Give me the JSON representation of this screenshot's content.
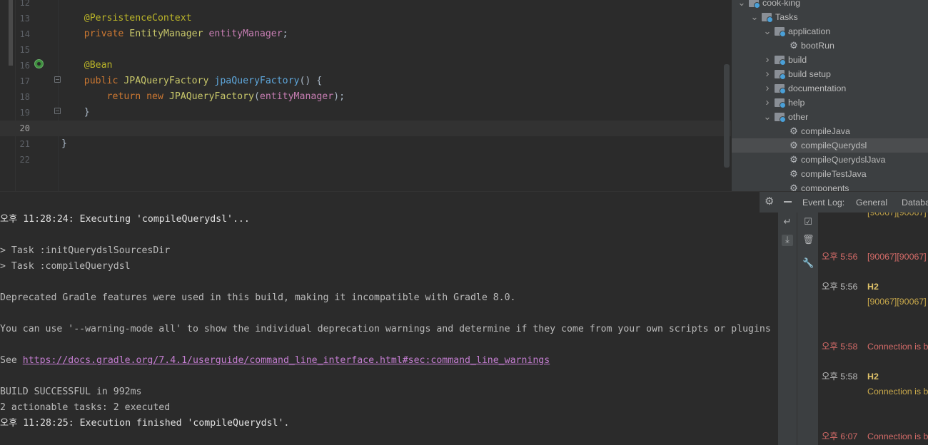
{
  "editor": {
    "lines": [
      {
        "num": "12",
        "tokens": []
      },
      {
        "num": "13",
        "tokens": [
          {
            "t": "    ",
            "c": "plain"
          },
          {
            "t": "@PersistenceContext",
            "c": "ann"
          }
        ]
      },
      {
        "num": "14",
        "tokens": [
          {
            "t": "    ",
            "c": "plain"
          },
          {
            "t": "private ",
            "c": "kw"
          },
          {
            "t": "EntityManager ",
            "c": "type"
          },
          {
            "t": "entityManager",
            "c": "field"
          },
          {
            "t": ";",
            "c": "plain"
          }
        ]
      },
      {
        "num": "15",
        "tokens": []
      },
      {
        "num": "16",
        "tokens": [
          {
            "t": "    ",
            "c": "plain"
          },
          {
            "t": "@Bean",
            "c": "ann"
          }
        ]
      },
      {
        "num": "17",
        "tokens": [
          {
            "t": "    ",
            "c": "plain"
          },
          {
            "t": "public ",
            "c": "kw"
          },
          {
            "t": "JPAQueryFactory ",
            "c": "type"
          },
          {
            "t": "jpaQueryFactory",
            "c": "fn"
          },
          {
            "t": "() {",
            "c": "plain"
          }
        ]
      },
      {
        "num": "18",
        "tokens": [
          {
            "t": "        ",
            "c": "plain"
          },
          {
            "t": "return new ",
            "c": "kw"
          },
          {
            "t": "JPAQueryFactory",
            "c": "type"
          },
          {
            "t": "(",
            "c": "plain"
          },
          {
            "t": "entityManager",
            "c": "field"
          },
          {
            "t": ");",
            "c": "plain"
          }
        ]
      },
      {
        "num": "19",
        "tokens": [
          {
            "t": "    }",
            "c": "plain"
          }
        ]
      },
      {
        "num": "20",
        "tokens": []
      },
      {
        "num": "21",
        "tokens": [
          {
            "t": "}",
            "c": "plain"
          }
        ]
      },
      {
        "num": "22",
        "tokens": []
      }
    ]
  },
  "gradle_tree": {
    "items": [
      {
        "label": "cook-king",
        "chevron": "open",
        "icon": "project-icon",
        "level": 0
      },
      {
        "label": "Tasks",
        "chevron": "open",
        "icon": "folder-icon",
        "level": 1
      },
      {
        "label": "application",
        "chevron": "open",
        "icon": "folder-icon",
        "level": 2
      },
      {
        "label": "bootRun",
        "chevron": "none",
        "icon": "gear-icon",
        "level": 3
      },
      {
        "label": "build",
        "chevron": "closed",
        "icon": "folder-icon",
        "level": 2
      },
      {
        "label": "build setup",
        "chevron": "closed",
        "icon": "folder-icon",
        "level": 2
      },
      {
        "label": "documentation",
        "chevron": "closed",
        "icon": "folder-icon",
        "level": 2
      },
      {
        "label": "help",
        "chevron": "closed",
        "icon": "folder-icon",
        "level": 2
      },
      {
        "label": "other",
        "chevron": "open",
        "icon": "folder-icon",
        "level": 2
      },
      {
        "label": "compileJava",
        "chevron": "none",
        "icon": "gear-icon",
        "level": 3
      },
      {
        "label": "compileQuerydsl",
        "chevron": "none",
        "icon": "gear-icon",
        "level": 3,
        "selected": true
      },
      {
        "label": "compileQuerydslJava",
        "chevron": "none",
        "icon": "gear-icon",
        "level": 3
      },
      {
        "label": "compileTestJava",
        "chevron": "none",
        "icon": "gear-icon",
        "level": 3
      },
      {
        "label": "components",
        "chevron": "none",
        "icon": "gear-icon",
        "level": 3
      }
    ]
  },
  "event_log_bar": {
    "label": "Event Log:",
    "tabs": [
      "General",
      "Databa"
    ]
  },
  "console": {
    "lines": [
      {
        "text": "오후 11:28:24: Executing 'compileQuerydsl'...",
        "bright": true
      },
      {
        "text": ""
      },
      {
        "text": "> Task :initQuerydslSourcesDir"
      },
      {
        "text": "> Task :compileQuerydsl"
      },
      {
        "text": ""
      },
      {
        "text": "Deprecated Gradle features were used in this build, making it incompatible with Gradle 8.0."
      },
      {
        "text": ""
      },
      {
        "text": "You can use '--warning-mode all' to show the individual deprecation warnings and determine if they come from your own scripts or plugins"
      },
      {
        "text": ""
      },
      {
        "text": "See ",
        "link": "https://docs.gradle.org/7.4.1/userguide/command_line_interface.html#sec:command_line_warnings"
      },
      {
        "text": ""
      },
      {
        "text": "BUILD SUCCESSFUL in 992ms"
      },
      {
        "text": "2 actionable tasks: 2 executed"
      },
      {
        "text": "오후 11:28:25: Execution finished 'compileQuerydsl'.",
        "bright": true
      }
    ]
  },
  "event_log": {
    "entries": [
      {
        "time": "",
        "title": "",
        "message": "[90067][90067]",
        "msg_color": "yellow"
      },
      {
        "time": "오후 5:56",
        "time_color": "red",
        "title": "",
        "message": "[90067][90067]",
        "msg_color": "red"
      },
      {
        "time": "오후 5:56",
        "time_color": "plain",
        "title": "H2",
        "message": "[90067][90067]",
        "msg_color": "yellow"
      },
      {
        "time": "오후 5:58",
        "time_color": "red",
        "title": "",
        "message": "Connection is b",
        "msg_color": "red"
      },
      {
        "time": "오후 5:58",
        "time_color": "plain",
        "title": "H2",
        "message": "Connection is b",
        "msg_color": "yellow"
      },
      {
        "time": "오후 6:07",
        "time_color": "red",
        "title": "",
        "message": "Connection is b",
        "msg_color": "red"
      }
    ]
  },
  "colors": {
    "editor_bg": "#2b2b2b",
    "panel_bg": "#3c3f41",
    "annotation": "#bbb529",
    "keyword": "#cc7832",
    "link": "#c57ed2",
    "error": "#d46b68"
  }
}
